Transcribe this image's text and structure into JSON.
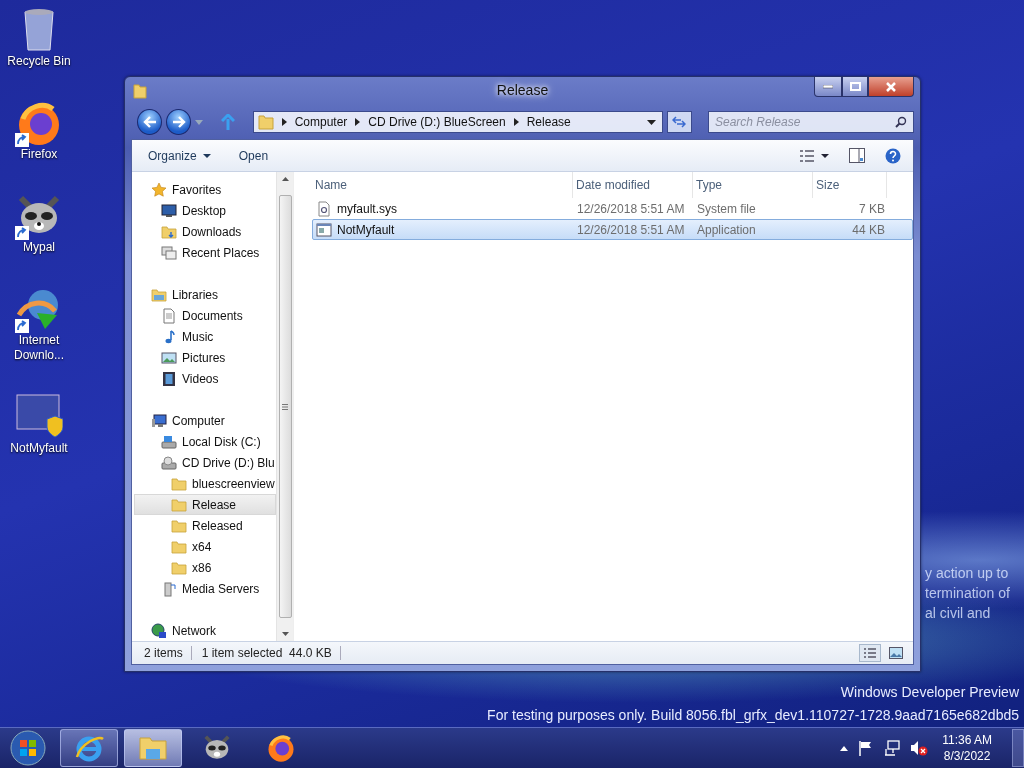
{
  "desktop": {
    "icons": [
      {
        "label": "Recycle Bin",
        "kind": "bin",
        "shortcut": false
      },
      {
        "label": "Firefox",
        "kind": "firefox",
        "shortcut": true
      },
      {
        "label": "Mypal",
        "kind": "raccoon",
        "shortcut": true
      },
      {
        "label": "Internet Downlo...",
        "kind": "globe",
        "shortcut": true
      },
      {
        "label": "NotMyfault",
        "kind": "app",
        "shortcut": false
      }
    ],
    "wallpaper_text": [
      "y action up to",
      "termination of",
      "al civil and"
    ],
    "build_notice": [
      "Windows Developer Preview",
      "For testing purposes only. Build 8056.fbl_grfx_dev1.110727-1728.9aad7165e682dbd5"
    ]
  },
  "window": {
    "title": "Release",
    "breadcrumb": [
      "Computer",
      "CD Drive (D:) BlueScreen",
      "Release"
    ],
    "search": {
      "placeholder": "Search Release"
    },
    "toolbar": [
      {
        "label": "Organize",
        "dropdown": true
      },
      {
        "label": "Open",
        "dropdown": false
      }
    ],
    "nav": [
      {
        "label": "Favorites",
        "kind": "star",
        "selected": false,
        "children": [
          {
            "label": "Desktop",
            "kind": "desktop",
            "selected": false
          },
          {
            "label": "Downloads",
            "kind": "downloads",
            "selected": false
          },
          {
            "label": "Recent Places",
            "kind": "recent",
            "selected": false
          }
        ]
      },
      {
        "label": "Libraries",
        "kind": "library",
        "selected": false,
        "children": [
          {
            "label": "Documents",
            "kind": "document",
            "selected": false
          },
          {
            "label": "Music",
            "kind": "music",
            "selected": false
          },
          {
            "label": "Pictures",
            "kind": "picture",
            "selected": false
          },
          {
            "label": "Videos",
            "kind": "video",
            "selected": false
          }
        ]
      },
      {
        "label": "Computer",
        "kind": "computer",
        "selected": false,
        "children": [
          {
            "label": "Local Disk (C:)",
            "kind": "disk",
            "selected": false
          },
          {
            "label": "CD Drive (D:) Blu",
            "kind": "cd",
            "selected": false,
            "children": [
              {
                "label": "bluescreenview",
                "kind": "folder",
                "selected": false
              },
              {
                "label": "Release",
                "kind": "folder",
                "selected": true
              },
              {
                "label": "Released",
                "kind": "folder",
                "selected": false
              },
              {
                "label": "x64",
                "kind": "folder",
                "selected": false
              },
              {
                "label": "x86",
                "kind": "folder",
                "selected": false
              }
            ]
          },
          {
            "label": "Media Servers",
            "kind": "media",
            "selected": false
          }
        ]
      },
      {
        "label": "Network",
        "kind": "network",
        "selected": false
      }
    ],
    "columns": [
      "Name",
      "Date modified",
      "Type",
      "Size"
    ],
    "rows": [
      {
        "name": "myfault.sys",
        "kind": "sysfile",
        "date": "12/26/2018 5:51 AM",
        "type": "System file",
        "size": "7 KB",
        "selected": false
      },
      {
        "name": "NotMyfault",
        "kind": "exe",
        "date": "12/26/2018 5:51 AM",
        "type": "Application",
        "size": "44 KB",
        "selected": true
      }
    ],
    "status": [
      "2 items",
      "1 item selected  44.0 KB"
    ]
  },
  "taskbar": {
    "apps": [
      {
        "kind": "ie",
        "running": true,
        "selected": false
      },
      {
        "kind": "explorer",
        "running": true,
        "selected": true
      },
      {
        "kind": "raccoon",
        "running": false,
        "selected": false
      },
      {
        "kind": "firefox",
        "running": false,
        "selected": false
      }
    ],
    "clock": {
      "time": "11:36 AM",
      "date": "8/3/2022"
    }
  }
}
